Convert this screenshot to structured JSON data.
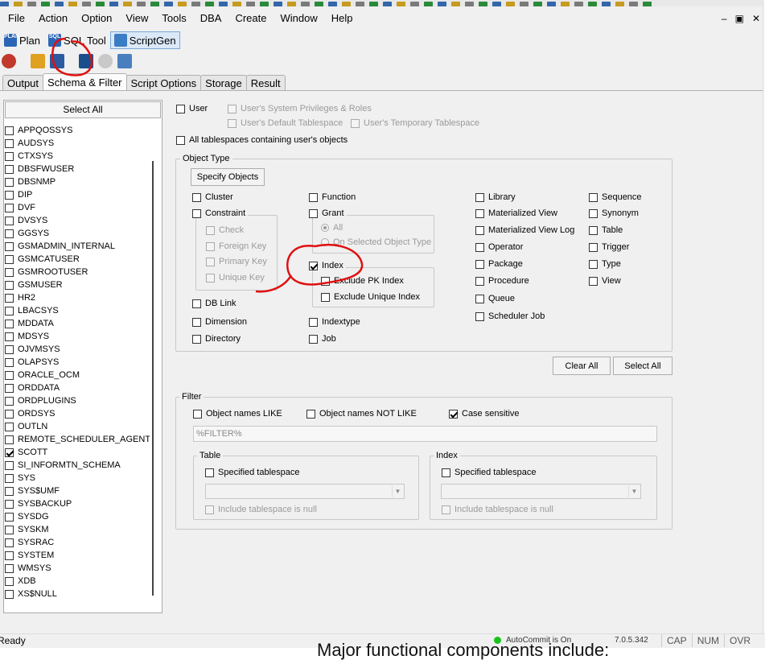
{
  "menu": [
    "File",
    "Action",
    "Option",
    "View",
    "Tools",
    "DBA",
    "Create",
    "Window",
    "Help"
  ],
  "window_controls": {
    "minimize": "–",
    "restore": "▣",
    "close": "✕"
  },
  "toolbar1": {
    "plan_label": "Plan",
    "sqltool_label": "SQL Tool",
    "scriptgen_label": "ScriptGen",
    "plan_icon_text": "PLAN",
    "sql_icon_text": "SQL"
  },
  "tabs": [
    "Output",
    "Schema & Filter",
    "Script Options",
    "Storage",
    "Result"
  ],
  "active_tab": "Schema & Filter",
  "schema": {
    "select_all_label": "Select All",
    "items": [
      {
        "name": "APPQOSSYS",
        "checked": false
      },
      {
        "name": "AUDSYS",
        "checked": false
      },
      {
        "name": "CTXSYS",
        "checked": false
      },
      {
        "name": "DBSFWUSER",
        "checked": false
      },
      {
        "name": "DBSNMP",
        "checked": false
      },
      {
        "name": "DIP",
        "checked": false
      },
      {
        "name": "DVF",
        "checked": false
      },
      {
        "name": "DVSYS",
        "checked": false
      },
      {
        "name": "GGSYS",
        "checked": false
      },
      {
        "name": "GSMADMIN_INTERNAL",
        "checked": false
      },
      {
        "name": "GSMCATUSER",
        "checked": false
      },
      {
        "name": "GSMROOTUSER",
        "checked": false
      },
      {
        "name": "GSMUSER",
        "checked": false
      },
      {
        "name": "HR2",
        "checked": false
      },
      {
        "name": "LBACSYS",
        "checked": false
      },
      {
        "name": "MDDATA",
        "checked": false
      },
      {
        "name": "MDSYS",
        "checked": false
      },
      {
        "name": "OJVMSYS",
        "checked": false
      },
      {
        "name": "OLAPSYS",
        "checked": false
      },
      {
        "name": "ORACLE_OCM",
        "checked": false
      },
      {
        "name": "ORDDATA",
        "checked": false
      },
      {
        "name": "ORDPLUGINS",
        "checked": false
      },
      {
        "name": "ORDSYS",
        "checked": false
      },
      {
        "name": "OUTLN",
        "checked": false
      },
      {
        "name": "REMOTE_SCHEDULER_AGENT",
        "checked": false
      },
      {
        "name": "SCOTT",
        "checked": true
      },
      {
        "name": "SI_INFORMTN_SCHEMA",
        "checked": false
      },
      {
        "name": "SYS",
        "checked": false
      },
      {
        "name": "SYS$UMF",
        "checked": false
      },
      {
        "name": "SYSBACKUP",
        "checked": false
      },
      {
        "name": "SYSDG",
        "checked": false
      },
      {
        "name": "SYSKM",
        "checked": false
      },
      {
        "name": "SYSRAC",
        "checked": false
      },
      {
        "name": "SYSTEM",
        "checked": false
      },
      {
        "name": "WMSYS",
        "checked": false
      },
      {
        "name": "XDB",
        "checked": false
      },
      {
        "name": "XS$NULL",
        "checked": false
      }
    ]
  },
  "user": {
    "user_label": "User",
    "sys_priv_label": "User's System Privileges & Roles",
    "default_ts_label": "User's Default Tablespace",
    "temp_ts_label": "User's Temporary Tablespace",
    "all_ts_label": "All tablespaces containing user's objects"
  },
  "object_type": {
    "title": "Object Type",
    "specify_label": "Specify Objects",
    "cluster": "Cluster",
    "constraint": "Constraint",
    "check": "Check",
    "foreign_key": "Foreign Key",
    "primary_key": "Primary Key",
    "unique_key": "Unique Key",
    "db_link": "DB Link",
    "dimension": "Dimension",
    "directory": "Directory",
    "function": "Function",
    "grant": "Grant",
    "grant_all": "All",
    "grant_selected": "On Selected Object Type",
    "index": "Index",
    "exclude_pk": "Exclude PK Index",
    "exclude_unique": "Exclude Unique Index",
    "indextype": "Indextype",
    "job": "Job",
    "library": "Library",
    "mat_view": "Materialized View",
    "mat_view_log": "Materialized View Log",
    "operator": "Operator",
    "package": "Package",
    "procedure": "Procedure",
    "queue": "Queue",
    "scheduler_job": "Scheduler Job",
    "sequence": "Sequence",
    "synonym": "Synonym",
    "table": "Table",
    "trigger": "Trigger",
    "type": "Type",
    "view": "View",
    "clear_all": "Clear All",
    "select_all": "Select All"
  },
  "filter": {
    "title": "Filter",
    "names_like": "Object names LIKE",
    "names_not_like": "Object names NOT LIKE",
    "case_sensitive": "Case sensitive",
    "filter_value": "%FILTER%",
    "table_title": "Table",
    "index_title": "Index",
    "specified_ts": "Specified tablespace",
    "include_null": "Include tablespace is null"
  },
  "status": {
    "ready": "Ready",
    "autocommit": "AutoCommit is On",
    "version": "7.0.5.342",
    "cap": "CAP",
    "num": "NUM",
    "ovr": "OVR"
  },
  "below_text": "Major functional components include:",
  "colors": {
    "accent": "#7aa7d8",
    "annotation": "#e01010",
    "led": "#19c21b"
  }
}
